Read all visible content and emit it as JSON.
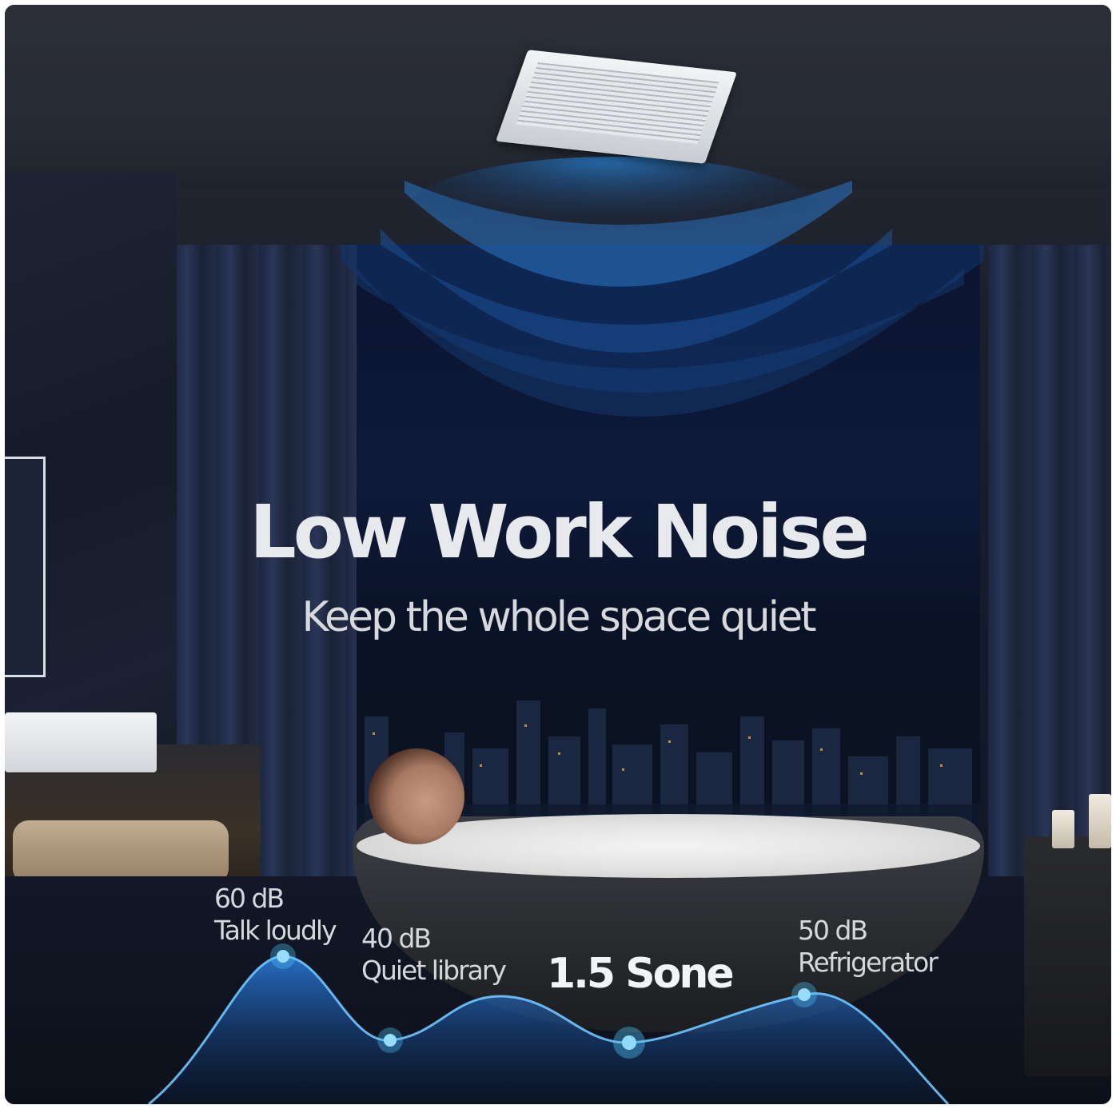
{
  "headline": "Low Work Noise",
  "subheadline": "Keep the whole space quiet",
  "noise_levels": [
    {
      "db": "60 dB",
      "description": "Talk loudly"
    },
    {
      "db": "40 dB",
      "description": "Quiet library"
    },
    {
      "db": "50 dB",
      "description": "Refrigerator"
    }
  ],
  "rating": "1.5 Sone",
  "colors": {
    "accent_glow": "#4fc3f7",
    "wave_blue": "#1e6fd9",
    "text": "#e8e9ec"
  }
}
